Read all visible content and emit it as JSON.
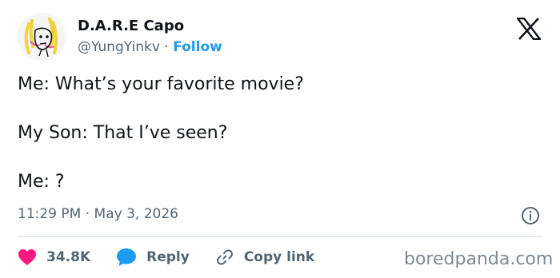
{
  "author": {
    "display_name": "D.A.R.E Capo",
    "handle": "@YungYinkv",
    "separator": "·",
    "follow_label": "Follow"
  },
  "tweet": {
    "line1": "Me: What’s your favorite movie?",
    "line2": "My Son: That I’ve seen?",
    "line3": "Me: ?"
  },
  "meta": {
    "time": "11:29 PM",
    "separator": "·",
    "date": "May 3, 2026"
  },
  "actions": {
    "likes": "34.8K",
    "reply_label": "Reply",
    "copy_label": "Copy link"
  },
  "watermark": "boredpanda.com",
  "icons": {
    "brand": "x-logo-icon",
    "info": "info-icon",
    "like": "heart-icon",
    "reply": "reply-bubble-icon",
    "copy": "link-icon"
  },
  "colors": {
    "text": "#0f1419",
    "secondary": "#536471",
    "follow": "#1d9bf0",
    "like": "#f91880",
    "reply": "#1d9bf0",
    "divider": "#cfd9de"
  }
}
